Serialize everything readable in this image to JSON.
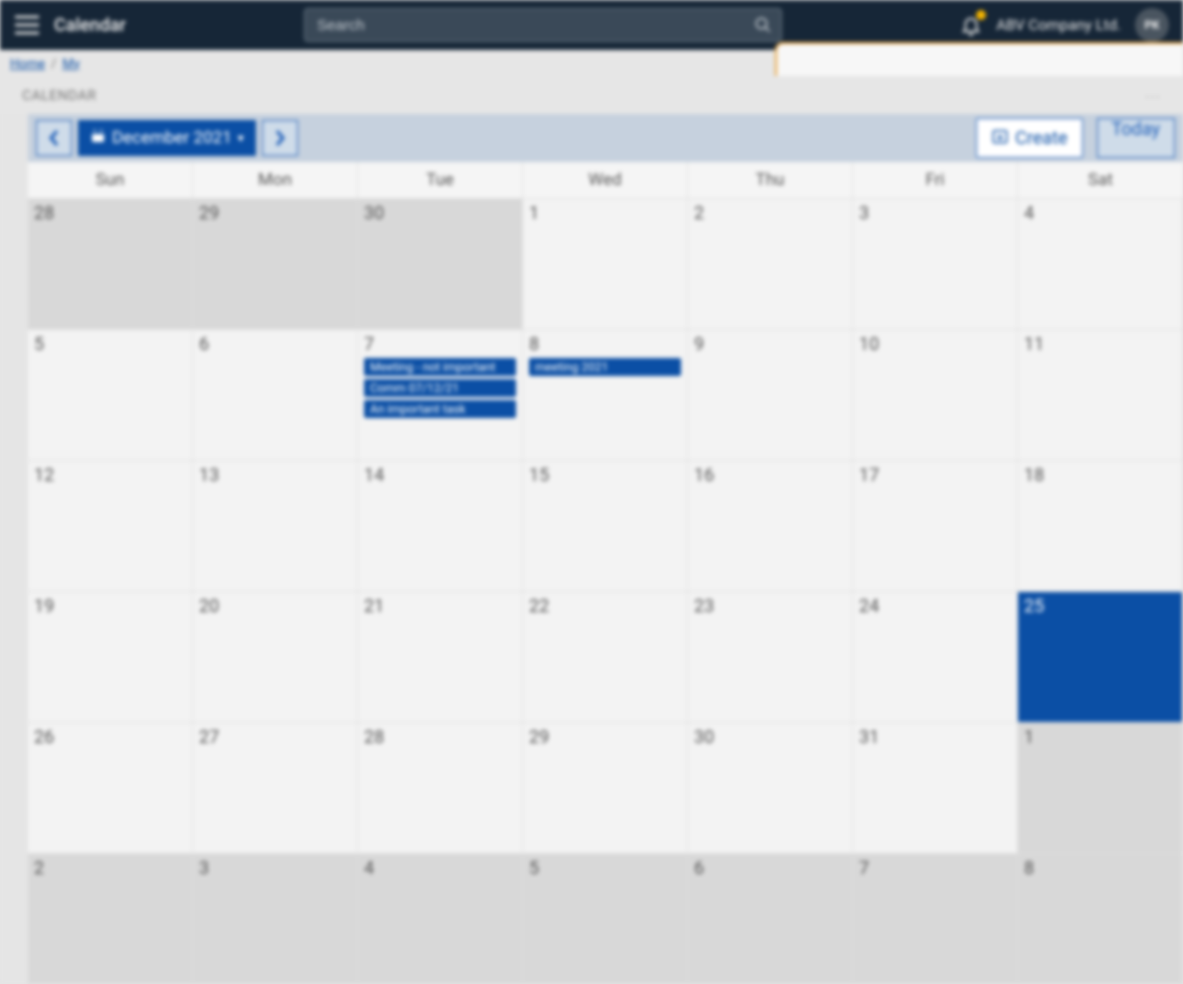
{
  "header": {
    "app_title": "Calendar",
    "search_placeholder": "Search",
    "company_name": "ABV Company Ltd.",
    "avatar_initials": "PK"
  },
  "breadcrumb": {
    "home": "Home",
    "my": "My"
  },
  "panel": {
    "title": "CALENDAR"
  },
  "toolbar": {
    "month_label": "December 2021",
    "create_label": "Create",
    "today_label": "Today"
  },
  "weekdays": [
    "Sun",
    "Mon",
    "Tue",
    "Wed",
    "Thu",
    "Fri",
    "Sat"
  ],
  "weeks": [
    [
      {
        "num": "28",
        "other": true
      },
      {
        "num": "29",
        "other": true
      },
      {
        "num": "30",
        "other": true
      },
      {
        "num": "1"
      },
      {
        "num": "2"
      },
      {
        "num": "3"
      },
      {
        "num": "4"
      }
    ],
    [
      {
        "num": "5"
      },
      {
        "num": "6"
      },
      {
        "num": "7",
        "events": [
          "Meeting - not important",
          "Comm 07/12/21",
          "An important task"
        ]
      },
      {
        "num": "8",
        "events": [
          "meeting 2021"
        ]
      },
      {
        "num": "9"
      },
      {
        "num": "10"
      },
      {
        "num": "11"
      }
    ],
    [
      {
        "num": "12"
      },
      {
        "num": "13"
      },
      {
        "num": "14"
      },
      {
        "num": "15"
      },
      {
        "num": "16"
      },
      {
        "num": "17"
      },
      {
        "num": "18"
      }
    ],
    [
      {
        "num": "19"
      },
      {
        "num": "20"
      },
      {
        "num": "21"
      },
      {
        "num": "22"
      },
      {
        "num": "23"
      },
      {
        "num": "24"
      },
      {
        "num": "25",
        "selected": true
      }
    ],
    [
      {
        "num": "26"
      },
      {
        "num": "27"
      },
      {
        "num": "28"
      },
      {
        "num": "29"
      },
      {
        "num": "30"
      },
      {
        "num": "31"
      },
      {
        "num": "1",
        "other": true
      }
    ],
    [
      {
        "num": "2",
        "other": true
      },
      {
        "num": "3",
        "other": true
      },
      {
        "num": "4",
        "other": true
      },
      {
        "num": "5",
        "other": true
      },
      {
        "num": "6",
        "other": true
      },
      {
        "num": "7",
        "other": true
      },
      {
        "num": "8",
        "other": true
      }
    ]
  ]
}
